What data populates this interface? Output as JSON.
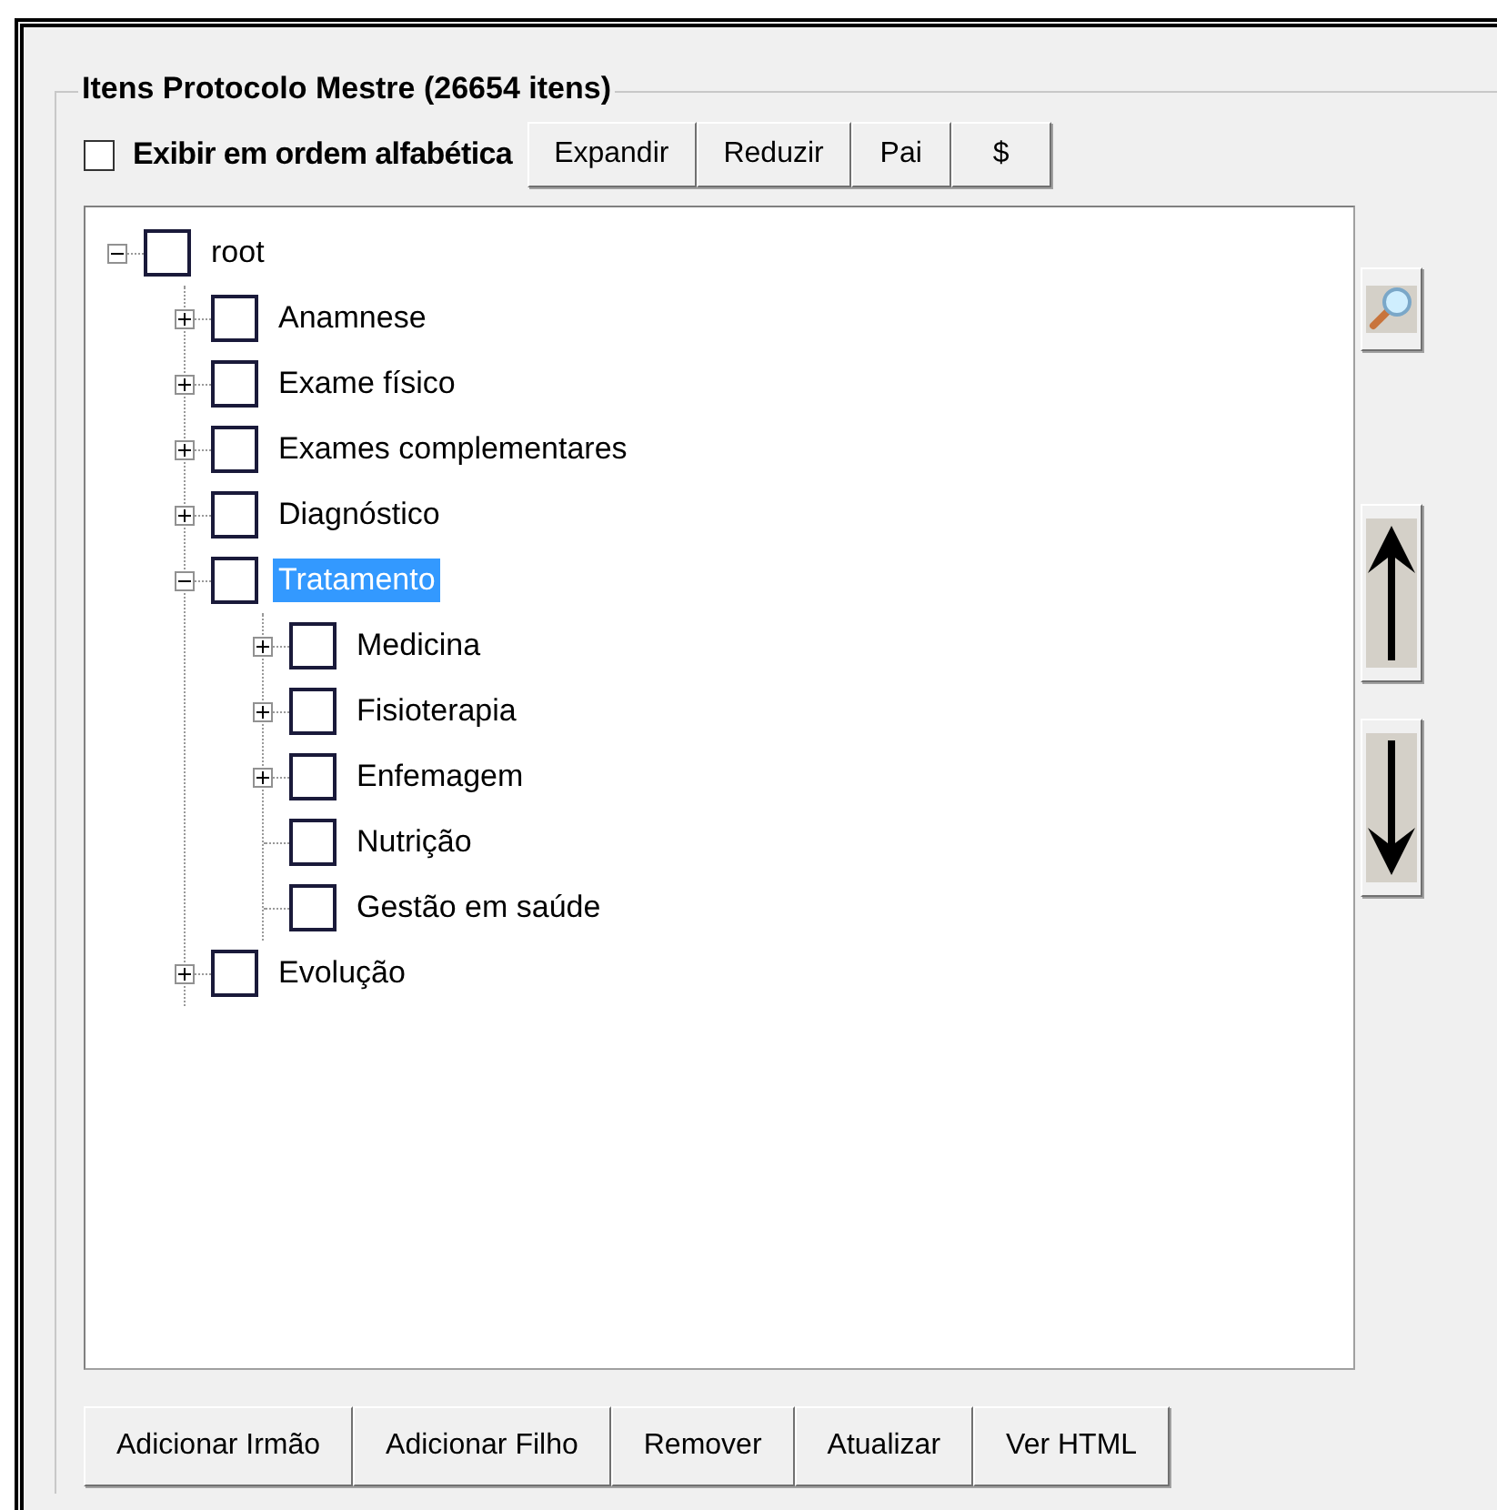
{
  "group": {
    "title": "Itens Protocolo Mestre (26654 itens)"
  },
  "alphabetical": {
    "label": "Exibir em ordem alfabética",
    "checked": false
  },
  "toolbar": [
    "Expandir",
    "Reduzir",
    "Pai",
    "$"
  ],
  "tree": [
    {
      "label": "root",
      "checked": false,
      "selected": false,
      "expanded": true,
      "children": [
        {
          "label": "Anamnese",
          "checked": false,
          "selected": false,
          "expanded": false
        },
        {
          "label": "Exame físico",
          "checked": false,
          "selected": false,
          "expanded": false
        },
        {
          "label": "Exames complementares",
          "checked": false,
          "selected": false,
          "expanded": false
        },
        {
          "label": "Diagnóstico",
          "checked": false,
          "selected": false,
          "expanded": false
        },
        {
          "label": "Tratamento",
          "checked": false,
          "selected": true,
          "expanded": true,
          "children": [
            {
              "label": "Medicina",
              "checked": false,
              "selected": false,
              "expanded": false
            },
            {
              "label": "Fisioterapia",
              "checked": false,
              "selected": false,
              "expanded": false
            },
            {
              "label": "Enfemagem",
              "checked": false,
              "selected": false,
              "expanded": false
            },
            {
              "label": "Nutrição",
              "checked": false,
              "selected": false
            },
            {
              "label": "Gestão em saúde",
              "checked": false,
              "selected": false
            }
          ]
        },
        {
          "label": "Evolução",
          "checked": false,
          "selected": false,
          "expanded": false
        }
      ]
    }
  ],
  "side_buttons": [
    {
      "kind": "search"
    },
    {
      "kind": "up"
    },
    {
      "kind": "down"
    }
  ],
  "bottom_buttons": [
    "Adicionar Irmão",
    "Adicionar Filho",
    "Remover",
    "Atualizar",
    "Ver HTML"
  ]
}
